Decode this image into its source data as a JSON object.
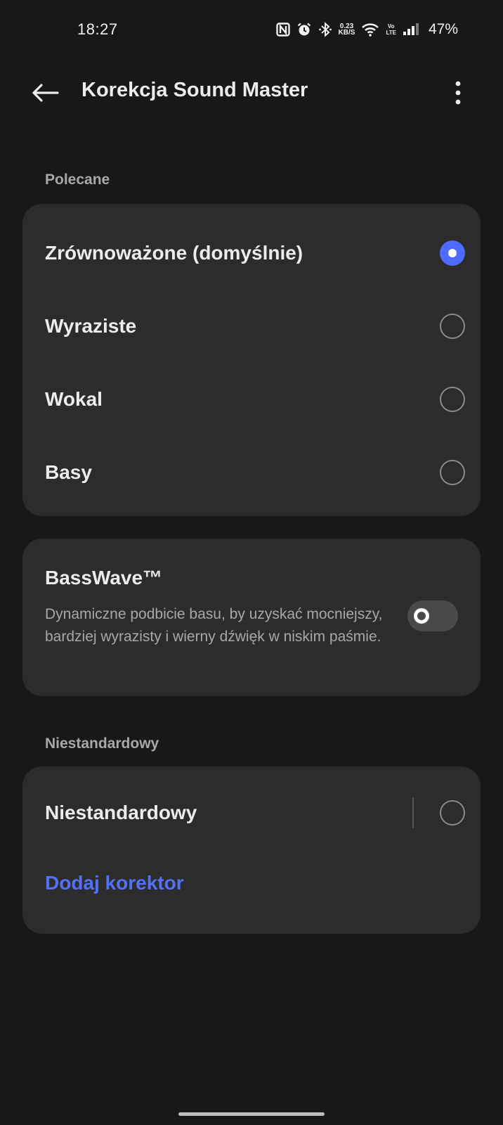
{
  "status_bar": {
    "time": "18:27",
    "net_speed_value": "0.23",
    "net_speed_unit": "KB/S",
    "volte_top": "Vo",
    "volte_bottom": "LTE",
    "battery": "47%",
    "icons": [
      "nfc-icon",
      "alarm-icon",
      "bluetooth-icon",
      "wifi-icon",
      "signal-icon"
    ]
  },
  "app_bar": {
    "title": "Korekcja Sound Master",
    "back_icon": "arrow-left-icon",
    "more_icon": "more-vertical-icon"
  },
  "recommended": {
    "header": "Polecane",
    "options": [
      {
        "label": "Zrównoważone (domyślnie)",
        "selected": true
      },
      {
        "label": "Wyraziste",
        "selected": false
      },
      {
        "label": "Wokal",
        "selected": false
      },
      {
        "label": "Basy",
        "selected": false
      }
    ]
  },
  "basswave": {
    "title": "BassWave™",
    "description": "Dynamiczne podbicie basu, by uzyskać mocniejszy, bardziej wyrazisty i wierny dźwięk w niskim paśmie.",
    "enabled": false
  },
  "custom": {
    "header": "Niestandardowy",
    "option_label": "Niestandardowy",
    "selected": false,
    "add_label": "Dodaj korektor"
  },
  "colors": {
    "background": "#181818",
    "card": "#2c2c2c",
    "accent": "#4d6bfe",
    "link": "#5470f5"
  }
}
